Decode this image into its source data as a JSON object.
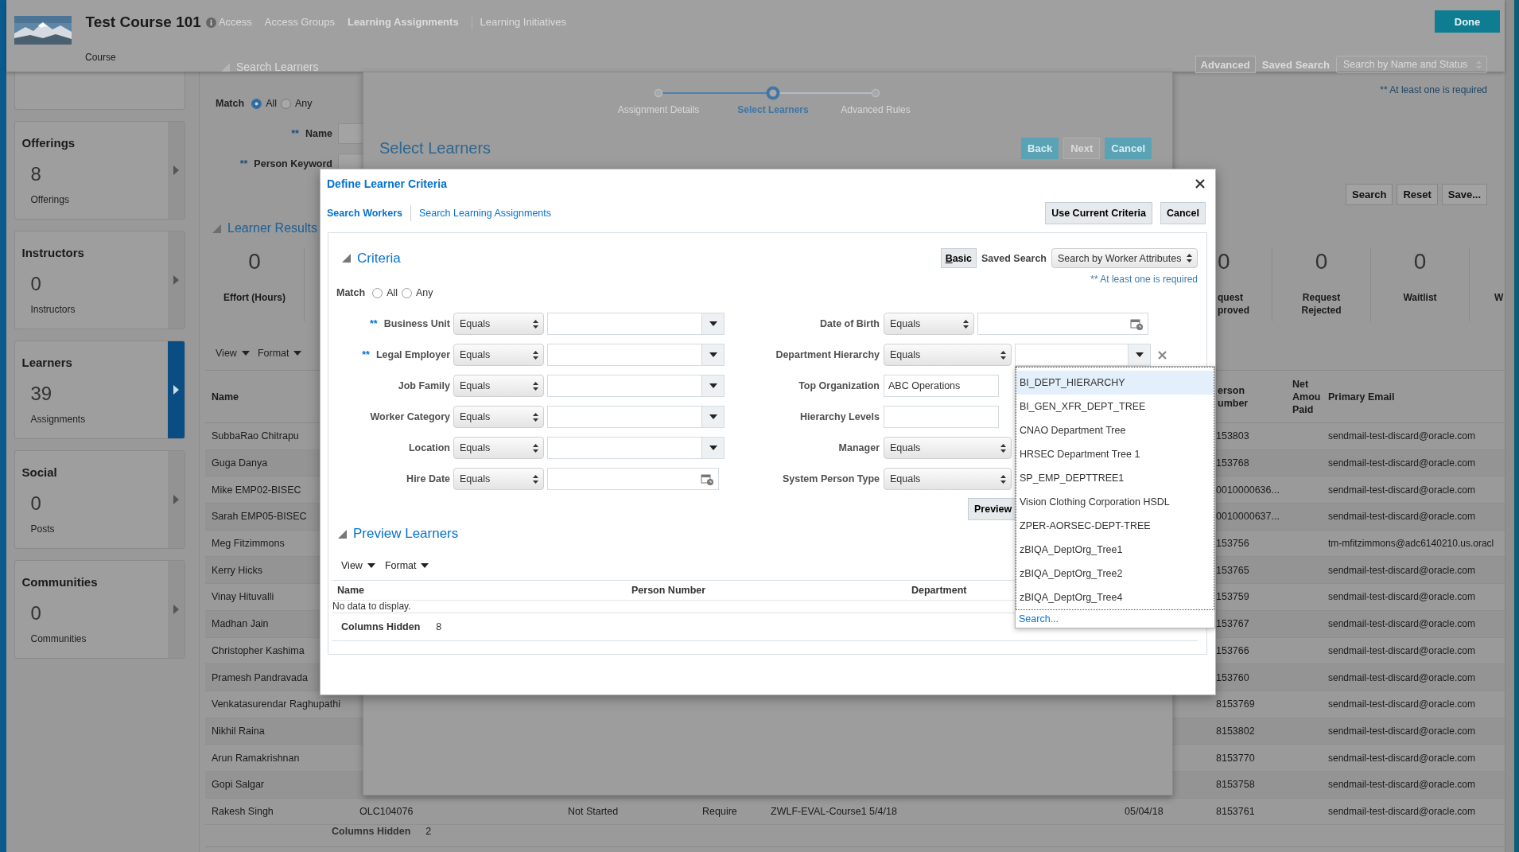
{
  "header": {
    "title": "Test Course 101",
    "subtitle": "Course",
    "tabs": [
      {
        "label": "Access",
        "selected": false
      },
      {
        "label": "Access Groups",
        "selected": false
      },
      {
        "label": "Learning Assignments",
        "selected": true
      },
      {
        "label": "Learning Initiatives",
        "selected": false
      }
    ],
    "done_button": "Done"
  },
  "sidebar": {
    "cards": [
      {
        "title": "Offerings",
        "count": "8",
        "caption": "Offerings",
        "selected": false
      },
      {
        "title": "Instructors",
        "count": "0",
        "caption": "Instructors",
        "selected": false
      },
      {
        "title": "Learners",
        "count": "39",
        "caption": "Assignments",
        "selected": true
      },
      {
        "title": "Social",
        "count": "0",
        "caption": "Posts",
        "selected": false
      },
      {
        "title": "Communities",
        "count": "0",
        "caption": "Communities",
        "selected": false
      }
    ]
  },
  "search": {
    "title": "Search Learners",
    "mode_button": "Advanced",
    "saved_search_label": "Saved Search",
    "saved_search": "Search by Name and Status",
    "match": {
      "label": "Match",
      "options": [
        {
          "label": "All",
          "selected": true
        },
        {
          "label": "Any",
          "selected": false
        }
      ]
    },
    "fields": [
      {
        "required_mark": "**",
        "label": "Name"
      },
      {
        "required_mark": "**",
        "label": "Person Keyword"
      }
    ],
    "required_note": "** At least one is required",
    "buttons": [
      "Search",
      "Reset",
      "Save..."
    ]
  },
  "results": {
    "title": "Learner Results",
    "metrics_left": [
      {
        "value": "0",
        "label": "Effort (Hours)"
      }
    ],
    "metrics_right": [
      {
        "value": "0",
        "label": "quest proved"
      },
      {
        "value": "0",
        "label": "Request Rejected"
      },
      {
        "value": "0",
        "label": "Waitlist"
      },
      {
        "label": "W"
      }
    ],
    "menus": [
      "View",
      "Format"
    ],
    "table": {
      "columns": [
        "Name",
        "erson umber",
        "Net Amou Paid",
        "Primary Email"
      ],
      "rows": [
        {
          "name": "SubbaRao Chitrapu",
          "person_number": "153803",
          "email": "sendmail-test-discard@oracle.com"
        },
        {
          "name": "Guga Danya",
          "person_number": "153768",
          "email": "sendmail-test-discard@oracle.com"
        },
        {
          "name": "Mike EMP02-BISEC",
          "person_number": "0010000636...",
          "email": "sendmail-test-discard@oracle.com"
        },
        {
          "name": "Sarah EMP05-BISEC",
          "person_number": "0010000637...",
          "email": "sendmail-test-discard@oracle.com"
        },
        {
          "name": "Meg Fitzimmons",
          "person_number": "153756",
          "email": "tm-mfitzimmons@adc6140210.us.oracl"
        },
        {
          "name": "Kerry Hicks",
          "person_number": "153765",
          "email": "sendmail-test-discard@oracle.com"
        },
        {
          "name": "Vinay Hituvalli",
          "person_number": "153759",
          "email": "sendmail-test-discard@oracle.com"
        },
        {
          "name": "Madhan Jain",
          "person_number": "153767",
          "email": "sendmail-test-discard@oracle.com"
        },
        {
          "name": "Christopher Kashima",
          "person_number": "153766",
          "email": "sendmail-test-discard@oracle.com"
        },
        {
          "name": "Pramesh Pandravada",
          "person_number": "153760",
          "email": "sendmail-test-discard@oracle.com"
        },
        {
          "name": "Venkatasurendar Raghupathi",
          "person_number": "8153769",
          "email": "sendmail-test-discard@oracle.com"
        },
        {
          "name": "Nikhil Raina",
          "person_number": "8153802",
          "email": "sendmail-test-discard@oracle.com"
        },
        {
          "name": "Arun Ramakrishnan",
          "person_number": "8153770",
          "email": "sendmail-test-discard@oracle.com"
        },
        {
          "name": "Gopi Salgar",
          "person_number": "8153758",
          "email": "sendmail-test-discard@oracle.com"
        },
        {
          "name": "Rakesh Singh",
          "code": "OLC104076",
          "status": "Not Started",
          "column_4": "Require",
          "assignment": "ZWLF-EVAL-Course1 5/4/18",
          "date": "05/04/18",
          "person_number": "8153761",
          "email": "sendmail-test-discard@oracle.com"
        }
      ],
      "columns_hidden_label": "Columns Hidden",
      "columns_hidden": "2"
    }
  },
  "wizard": {
    "steps": [
      {
        "label": "Assignment Details",
        "selected": false
      },
      {
        "label": "Select Learners",
        "selected": true
      },
      {
        "label": "Advanced Rules",
        "selected": false
      }
    ],
    "title": "Select Learners",
    "buttons": [
      {
        "label": "Back",
        "disabled": false
      },
      {
        "label": "Next",
        "disabled": true
      },
      {
        "label": "Cancel",
        "disabled": false
      }
    ]
  },
  "dialog": {
    "title": "Define Learner Criteria",
    "tabs": [
      {
        "label": "Search Workers",
        "selected": true
      },
      {
        "label": "Search Learning Assignments",
        "selected": false
      }
    ],
    "buttons": [
      "Use Current Criteria",
      "Cancel"
    ],
    "criteria": {
      "title": "Criteria",
      "mode_button": "Basic",
      "saved_search_label": "Saved Search",
      "saved_search": "Search by Worker Attributes",
      "required_note": "** At least one is required",
      "match": {
        "label": "Match",
        "options": [
          {
            "label": "All",
            "selected": false
          },
          {
            "label": "Any",
            "selected": false
          }
        ]
      },
      "left_fields": [
        {
          "kind": "combo",
          "required_mark": "**",
          "label": "Business Unit",
          "operator": "Equals",
          "clearable": false
        },
        {
          "kind": "combo",
          "required_mark": "**",
          "label": "Legal Employer",
          "operator": "Equals",
          "clearable": false
        },
        {
          "kind": "combo",
          "label": "Job Family",
          "operator": "Equals",
          "clearable": false
        },
        {
          "kind": "combo",
          "label": "Worker Category",
          "operator": "Equals",
          "clearable": false
        },
        {
          "kind": "combo",
          "label": "Location",
          "operator": "Equals",
          "clearable": false
        },
        {
          "kind": "date",
          "label": "Hire Date",
          "operator": "Equals",
          "clearable": false
        }
      ],
      "right_fields": [
        {
          "kind": "date",
          "label": "Date of Birth",
          "operator": "Equals",
          "clearable": false
        },
        {
          "kind": "combo",
          "label": "Department Hierarchy",
          "operator": "Equals",
          "clearable": true
        },
        {
          "kind": "text",
          "label": "Top Organization",
          "value": "ABC Operations",
          "clearable": false
        },
        {
          "kind": "text",
          "label": "Hierarchy Levels",
          "clearable": false
        },
        {
          "kind": "select",
          "label": "Manager",
          "operator": "Equals",
          "clearable": false
        },
        {
          "kind": "select",
          "label": "System Person Type",
          "operator": "Equals",
          "clearable": false
        }
      ],
      "preview_button": "Preview"
    },
    "preview": {
      "title": "Preview Learners",
      "menus": [
        "View",
        "Format"
      ],
      "columns": [
        "Name",
        "Person Number",
        "Department"
      ],
      "empty_text": "No data to display.",
      "columns_hidden_label": "Columns Hidden",
      "columns_hidden": "8"
    },
    "dropdown": {
      "items": [
        {
          "label": "BI_DEPT_HIERARCHY",
          "selected": true
        },
        {
          "label": "BI_GEN_XFR_DEPT_TREE",
          "selected": false
        },
        {
          "label": "CNAO Department Tree",
          "selected": false
        },
        {
          "label": "HRSEC Department Tree 1",
          "selected": false
        },
        {
          "label": "SP_EMP_DEPTTREE1",
          "selected": false
        },
        {
          "label": "Vision Clothing Corporation HSDL",
          "selected": false
        },
        {
          "label": "ZPER-AORSEC-DEPT-TREE",
          "selected": false
        },
        {
          "label": "zBIQA_DeptOrg_Tree1",
          "selected": false
        },
        {
          "label": "zBIQA_DeptOrg_Tree2",
          "selected": false
        },
        {
          "label": "zBIQA_DeptOrg_Tree4",
          "selected": false
        }
      ],
      "search_link": "Search..."
    }
  }
}
